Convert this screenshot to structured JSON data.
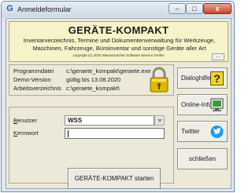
{
  "window": {
    "title": "Anmeldeformular",
    "icon_letter": "G"
  },
  "titlebar_buttons": {
    "minimize": "–",
    "maximize": "□",
    "close": "x"
  },
  "header": {
    "title": "GERÄTE-KOMPAKT",
    "subtitle_line1": "Inventarverzeichnis, Termine und Dokumentenverwaltung für Werkzeuge,",
    "subtitle_line2": "Maschinen, Fahrzeuge, Büroinventar und sonstige Geräte aller Art",
    "copyright": "copyright (c) 2020 Wannemacher Software Service GmbH",
    "dots_button": "..."
  },
  "info": {
    "rows": [
      {
        "label": "Programmdatei",
        "value": "c:\\geraete_kompakt\\geraete.exe"
      },
      {
        "label": "Demo-Version",
        "value": "gültig bis 13.08.2020"
      },
      {
        "label": "Arbeitsverzeichnis",
        "value": "c:\\geraete_kompakt\\"
      }
    ]
  },
  "side_buttons": {
    "dialoghilfe": "Dialoghilfe",
    "online_info": "Online-Info",
    "twitter": "Twitter",
    "schliessen": "schließen"
  },
  "login": {
    "user_label_first": "B",
    "user_label_rest": "enutzer",
    "user_value": "WSS",
    "password_label_first": "K",
    "password_label_rest": "ennwort",
    "password_value": "",
    "start_button": "GERÄTE-KOMPAKT starten"
  },
  "colors": {
    "header_bg": "#f7f3c8",
    "client_bg": "#ece9d8",
    "close_button": "#c8442c",
    "twitter_blue": "#1d9bf0",
    "lock_gold": "#e0b800"
  }
}
